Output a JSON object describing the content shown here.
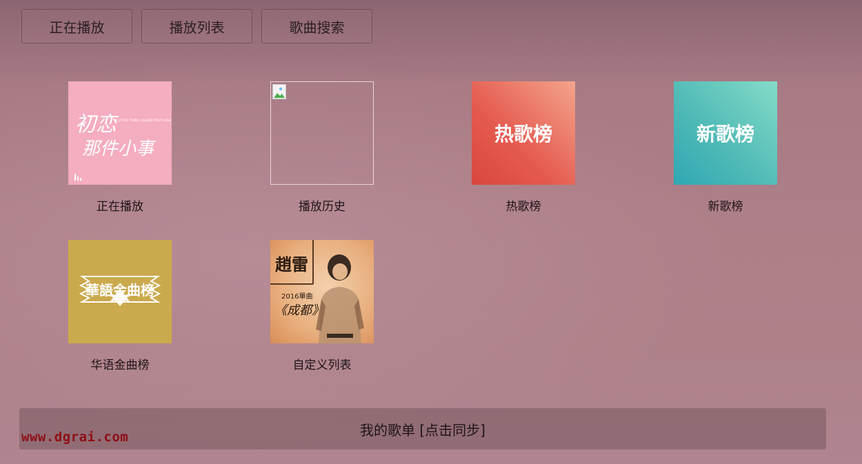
{
  "tabs": [
    "正在播放",
    "播放列表",
    "歌曲搜索"
  ],
  "cards": [
    {
      "label": "正在播放",
      "cover": {
        "line1": "初恋",
        "line2": "那件小事",
        "sub": "A LITTLE THING CALLED FIRST LOVE"
      }
    },
    {
      "label": "播放历史"
    },
    {
      "label": "热歌榜",
      "cover": {
        "title": "热歌榜"
      }
    },
    {
      "label": "新歌榜",
      "cover": {
        "title": "新歌榜"
      }
    },
    {
      "label": "华语金曲榜",
      "cover": {
        "title": "華語金曲榜"
      }
    },
    {
      "label": "自定义列表",
      "cover": {
        "artist": "趙雷",
        "year": "2016單曲",
        "song": "《成都》"
      }
    }
  ],
  "bottom_bar": {
    "label": "我的歌单 [点击同步]"
  },
  "watermark": "www.dgrai.com",
  "colors": {
    "hot_chart": "#e55a4f",
    "new_chart": "#52bbb7",
    "gold_chart": "#cba94d",
    "now_playing": "#f5adc0"
  }
}
